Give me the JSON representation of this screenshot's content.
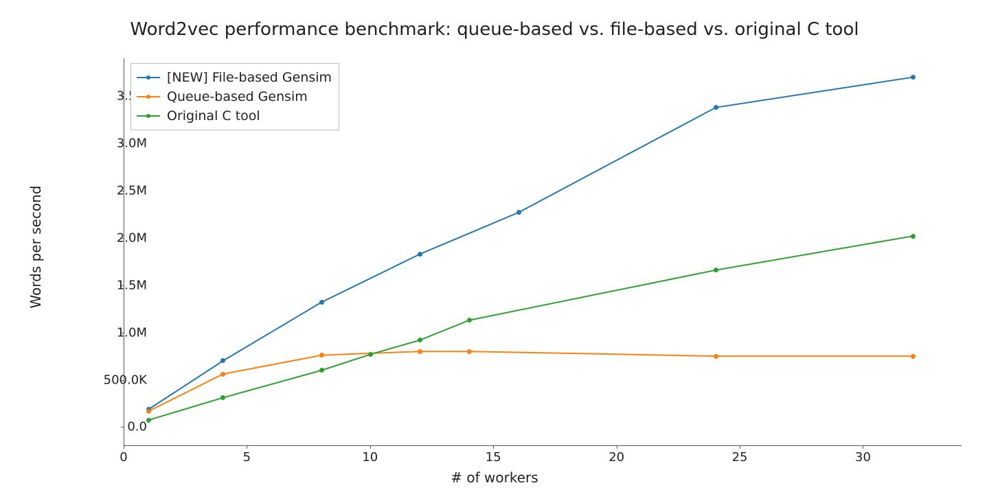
{
  "chart_data": {
    "type": "line",
    "title": "Word2vec performance benchmark: queue-based vs. file-based vs. original C tool",
    "xlabel": "# of workers",
    "ylabel": "Words per second",
    "xlim": [
      0,
      34
    ],
    "ylim": [
      -200000,
      3900000
    ],
    "xticks": [
      0,
      5,
      10,
      15,
      20,
      25,
      30
    ],
    "yticks": [
      0,
      500000,
      1000000,
      1500000,
      2000000,
      2500000,
      3000000,
      3500000
    ],
    "ytick_labels": [
      "0.0",
      "500.0K",
      "1.0M",
      "1.5M",
      "2.0M",
      "2.5M",
      "3.0M",
      "3.5M"
    ],
    "x": [
      1,
      4,
      8,
      10,
      12,
      14,
      16,
      24,
      32
    ],
    "series": [
      {
        "name": "[NEW] File-based Gensim",
        "color": "#1f77b4",
        "values": [
          190000,
          700000,
          1320000,
          null,
          1830000,
          null,
          2270000,
          3380000,
          3700000
        ]
      },
      {
        "name": "Queue-based Gensim",
        "color": "#ff7f0e",
        "values": [
          170000,
          560000,
          760000,
          null,
          800000,
          800000,
          null,
          750000,
          750000
        ]
      },
      {
        "name": "Original C tool",
        "color": "#2ca02c",
        "values": [
          75000,
          310000,
          600000,
          770000,
          920000,
          1130000,
          null,
          1660000,
          2020000
        ]
      }
    ],
    "legend_position": "upper left"
  }
}
